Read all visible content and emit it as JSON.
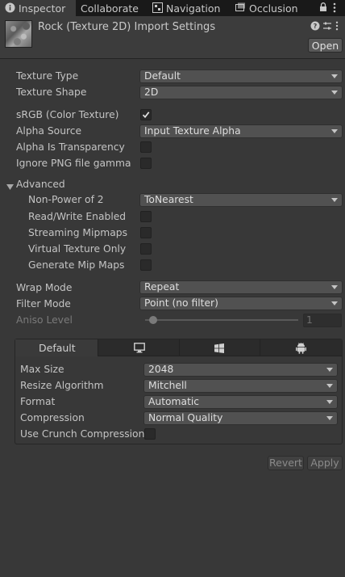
{
  "tabs": [
    {
      "label": "Inspector",
      "icon": "info-icon",
      "active": true
    },
    {
      "label": "Collaborate",
      "icon": "cloud-icon",
      "active": false
    },
    {
      "label": "Navigation",
      "icon": "navigation-icon",
      "active": false
    },
    {
      "label": "Occlusion",
      "icon": "occlusion-icon",
      "active": false
    }
  ],
  "header": {
    "title": "Rock (Texture 2D) Import Settings",
    "open_label": "Open"
  },
  "settings": {
    "texture_type": {
      "label": "Texture Type",
      "value": "Default"
    },
    "texture_shape": {
      "label": "Texture Shape",
      "value": "2D"
    },
    "srgb": {
      "label": "sRGB (Color Texture)",
      "checked": true
    },
    "alpha_source": {
      "label": "Alpha Source",
      "value": "Input Texture Alpha"
    },
    "alpha_transparency": {
      "label": "Alpha Is Transparency",
      "checked": false
    },
    "ignore_png_gamma": {
      "label": "Ignore PNG file gamma",
      "checked": false
    },
    "advanced": {
      "label": "Advanced",
      "non_power_of_2": {
        "label": "Non-Power of 2",
        "value": "ToNearest"
      },
      "read_write": {
        "label": "Read/Write Enabled",
        "checked": false
      },
      "streaming_mipmaps": {
        "label": "Streaming Mipmaps",
        "checked": false
      },
      "virtual_texture": {
        "label": "Virtual Texture Only",
        "checked": false
      },
      "generate_mipmaps": {
        "label": "Generate Mip Maps",
        "checked": false
      }
    },
    "wrap_mode": {
      "label": "Wrap Mode",
      "value": "Repeat"
    },
    "filter_mode": {
      "label": "Filter Mode",
      "value": "Point (no filter)"
    },
    "aniso_level": {
      "label": "Aniso Level",
      "value": "1"
    }
  },
  "platform": {
    "tabs": [
      {
        "label": "Default",
        "icon": null,
        "active": true
      },
      {
        "label": "",
        "icon": "monitor-icon",
        "active": false
      },
      {
        "label": "",
        "icon": "windows-icon",
        "active": false
      },
      {
        "label": "",
        "icon": "android-icon",
        "active": false
      }
    ],
    "max_size": {
      "label": "Max Size",
      "value": "2048"
    },
    "resize_algorithm": {
      "label": "Resize Algorithm",
      "value": "Mitchell"
    },
    "format": {
      "label": "Format",
      "value": "Automatic"
    },
    "compression": {
      "label": "Compression",
      "value": "Normal Quality"
    },
    "crunch": {
      "label": "Use Crunch Compression",
      "checked": false
    }
  },
  "footer": {
    "revert_label": "Revert",
    "apply_label": "Apply"
  }
}
